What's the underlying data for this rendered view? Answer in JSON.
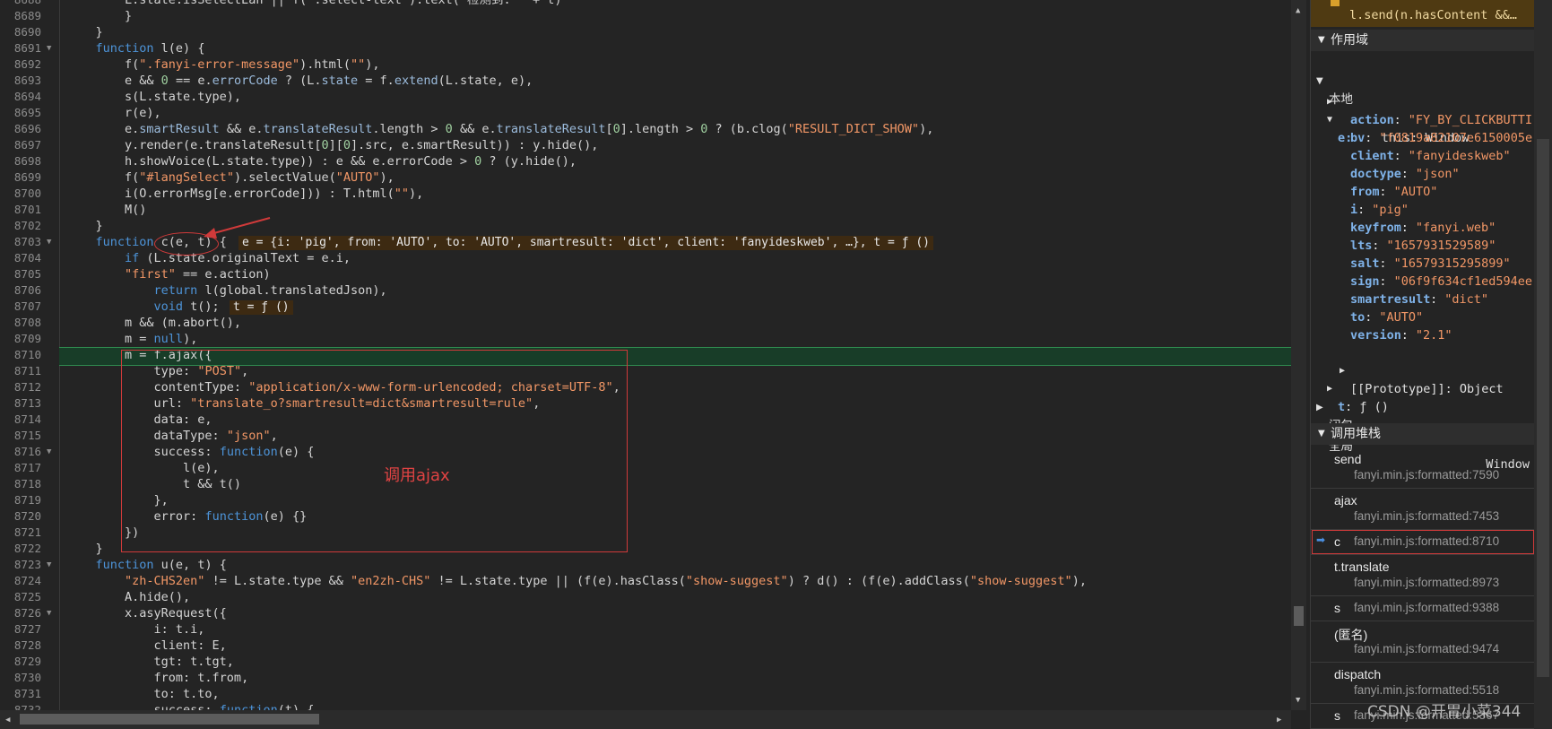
{
  "editor": {
    "lines": [
      {
        "n": "8688",
        "segs": [
          [
            "t-c",
            "        L.state.isSelectEan || f(\".select-text\").text(\"检测到: \" + t)"
          ]
        ]
      },
      {
        "n": "8689",
        "segs": [
          [
            "t-c",
            "        }"
          ]
        ]
      },
      {
        "n": "8690",
        "segs": [
          [
            "t-c",
            "    }"
          ]
        ]
      },
      {
        "n": "8691",
        "fold": true,
        "segs": [
          [
            "t-k",
            "    function"
          ],
          [
            "t-c",
            " l(e) {"
          ]
        ]
      },
      {
        "n": "8692",
        "segs": [
          [
            "t-c",
            "        f("
          ],
          [
            "t-s",
            "\".fanyi-error-message\""
          ],
          [
            "t-c",
            ").html("
          ],
          [
            "t-s",
            "\"\""
          ],
          [
            "t-c",
            "),"
          ]
        ]
      },
      {
        "n": "8693",
        "segs": [
          [
            "t-c",
            "        e && "
          ],
          [
            "t-n",
            "0"
          ],
          [
            "t-c",
            " == e."
          ],
          [
            "t-p",
            "errorCode"
          ],
          [
            "t-c",
            " ? (L."
          ],
          [
            "t-p",
            "state"
          ],
          [
            "t-c",
            " = f."
          ],
          [
            "t-p",
            "extend"
          ],
          [
            "t-c",
            "(L.state, e),"
          ]
        ]
      },
      {
        "n": "8694",
        "segs": [
          [
            "t-c",
            "        s(L.state.type),"
          ]
        ]
      },
      {
        "n": "8695",
        "segs": [
          [
            "t-c",
            "        r(e),"
          ]
        ]
      },
      {
        "n": "8696",
        "segs": [
          [
            "t-c",
            "        e."
          ],
          [
            "t-p",
            "smartResult"
          ],
          [
            "t-c",
            " && e."
          ],
          [
            "t-p",
            "translateResult"
          ],
          [
            "t-c",
            ".length > "
          ],
          [
            "t-n",
            "0"
          ],
          [
            "t-c",
            " && e."
          ],
          [
            "t-p",
            "translateResult"
          ],
          [
            "t-c",
            "["
          ],
          [
            "t-n",
            "0"
          ],
          [
            "t-c",
            "].length > "
          ],
          [
            "t-n",
            "0"
          ],
          [
            "t-c",
            " ? (b.clog("
          ],
          [
            "t-s",
            "\"RESULT_DICT_SHOW\""
          ],
          [
            "t-c",
            "),"
          ]
        ]
      },
      {
        "n": "8697",
        "segs": [
          [
            "t-c",
            "        y.render(e.translateResult["
          ],
          [
            "t-n",
            "0"
          ],
          [
            "t-c",
            "]["
          ],
          [
            "t-n",
            "0"
          ],
          [
            "t-c",
            "].src, e.smartResult)) : y.hide(),"
          ]
        ]
      },
      {
        "n": "8698",
        "segs": [
          [
            "t-c",
            "        h.showVoice(L.state.type)) : e && e.errorCode > "
          ],
          [
            "t-n",
            "0"
          ],
          [
            "t-c",
            " ? (y.hide(),"
          ]
        ]
      },
      {
        "n": "8699",
        "segs": [
          [
            "t-c",
            "        f("
          ],
          [
            "t-s",
            "\"#langSelect\""
          ],
          [
            "t-c",
            ").selectValue("
          ],
          [
            "t-s",
            "\"AUTO\""
          ],
          [
            "t-c",
            "),"
          ]
        ]
      },
      {
        "n": "8700",
        "segs": [
          [
            "t-c",
            "        i(O.errorMsg[e.errorCode])) : T.html("
          ],
          [
            "t-s",
            "\"\""
          ],
          [
            "t-c",
            "),"
          ]
        ]
      },
      {
        "n": "8701",
        "segs": [
          [
            "t-c",
            "        M()"
          ]
        ]
      },
      {
        "n": "8702",
        "segs": [
          [
            "t-c",
            "    }"
          ]
        ]
      },
      {
        "n": "8703",
        "fold": true,
        "segs": [
          [
            "t-k",
            "    function"
          ],
          [
            "t-c",
            " c(e, t) {"
          ]
        ]
      },
      {
        "n": "8704",
        "segs": [
          [
            "t-c",
            "        "
          ],
          [
            "t-k",
            "if"
          ],
          [
            "t-c",
            " (L.state.originalText = e.i,"
          ]
        ]
      },
      {
        "n": "8705",
        "segs": [
          [
            "t-s",
            "        \"first\""
          ],
          [
            "t-c",
            " == e.action)"
          ]
        ]
      },
      {
        "n": "8706",
        "segs": [
          [
            "t-k",
            "            return"
          ],
          [
            "t-c",
            " l(global.translatedJson),"
          ]
        ]
      },
      {
        "n": "8707",
        "segs": [
          [
            "t-k",
            "            void"
          ],
          [
            "t-c",
            " t();"
          ]
        ]
      },
      {
        "n": "8708",
        "segs": [
          [
            "t-c",
            "        m && (m.abort(),"
          ]
        ]
      },
      {
        "n": "8709",
        "segs": [
          [
            "t-c",
            "        m = "
          ],
          [
            "t-k",
            "null"
          ],
          [
            "t-c",
            "),"
          ]
        ]
      },
      {
        "n": "8710",
        "segs": [
          [
            "t-c",
            "        m = f.ajax({"
          ]
        ]
      },
      {
        "n": "8711",
        "segs": [
          [
            "t-c",
            "            type: "
          ],
          [
            "t-s",
            "\"POST\""
          ],
          [
            "t-c",
            ","
          ]
        ]
      },
      {
        "n": "8712",
        "segs": [
          [
            "t-c",
            "            contentType: "
          ],
          [
            "t-s",
            "\"application/x-www-form-urlencoded; charset=UTF-8\""
          ],
          [
            "t-c",
            ","
          ]
        ]
      },
      {
        "n": "8713",
        "segs": [
          [
            "t-c",
            "            url: "
          ],
          [
            "t-s",
            "\"translate_o?smartresult=dict&smartresult=rule\""
          ],
          [
            "t-c",
            ","
          ]
        ]
      },
      {
        "n": "8714",
        "segs": [
          [
            "t-c",
            "            data: e,"
          ]
        ]
      },
      {
        "n": "8715",
        "segs": [
          [
            "t-c",
            "            dataType: "
          ],
          [
            "t-s",
            "\"json\""
          ],
          [
            "t-c",
            ","
          ]
        ]
      },
      {
        "n": "8716",
        "fold": true,
        "segs": [
          [
            "t-c",
            "            success: "
          ],
          [
            "t-k",
            "function"
          ],
          [
            "t-c",
            "(e) {"
          ]
        ]
      },
      {
        "n": "8717",
        "segs": [
          [
            "t-c",
            "                l(e),"
          ]
        ]
      },
      {
        "n": "8718",
        "segs": [
          [
            "t-c",
            "                t && t()"
          ]
        ]
      },
      {
        "n": "8719",
        "segs": [
          [
            "t-c",
            "            },"
          ]
        ]
      },
      {
        "n": "8720",
        "segs": [
          [
            "t-c",
            "            error: "
          ],
          [
            "t-k",
            "function"
          ],
          [
            "t-c",
            "(e) {}"
          ]
        ]
      },
      {
        "n": "8721",
        "segs": [
          [
            "t-c",
            "        })"
          ]
        ]
      },
      {
        "n": "8722",
        "segs": [
          [
            "t-c",
            "    }"
          ]
        ]
      },
      {
        "n": "8723",
        "fold": true,
        "segs": [
          [
            "t-k",
            "    function"
          ],
          [
            "t-c",
            " u(e, t) {"
          ]
        ]
      },
      {
        "n": "8724",
        "segs": [
          [
            "t-s",
            "        \"zh-CHS2en\""
          ],
          [
            "t-c",
            " != L.state.type && "
          ],
          [
            "t-s",
            "\"en2zh-CHS\""
          ],
          [
            "t-c",
            " != L.state.type || (f(e).hasClass("
          ],
          [
            "t-s",
            "\"show-suggest\""
          ],
          [
            "t-c",
            ") ? d() : (f(e).addClass("
          ],
          [
            "t-s",
            "\"show-suggest\""
          ],
          [
            "t-c",
            "),"
          ]
        ]
      },
      {
        "n": "8725",
        "segs": [
          [
            "t-c",
            "        A.hide(),"
          ]
        ]
      },
      {
        "n": "8726",
        "fold": true,
        "segs": [
          [
            "t-c",
            "        x.asyRequest({"
          ]
        ]
      },
      {
        "n": "8727",
        "segs": [
          [
            "t-c",
            "            i: t.i,"
          ]
        ]
      },
      {
        "n": "8728",
        "segs": [
          [
            "t-c",
            "            client: E,"
          ]
        ]
      },
      {
        "n": "8729",
        "segs": [
          [
            "t-c",
            "            tgt: t.tgt,"
          ]
        ]
      },
      {
        "n": "8730",
        "segs": [
          [
            "t-c",
            "            from: t.from,"
          ]
        ]
      },
      {
        "n": "8731",
        "segs": [
          [
            "t-c",
            "            to: t.to,"
          ]
        ]
      },
      {
        "n": "8732",
        "segs": [
          [
            "t-c",
            "            success: "
          ],
          [
            "t-k",
            "function"
          ],
          [
            "t-c",
            "(t) {"
          ]
        ]
      }
    ],
    "inline_values": {
      "line_8703": "e = {i: 'pig', from: 'AUTO', to: 'AUTO', smartresult: 'dict', client: 'fanyideskweb', …}, t = ƒ ()",
      "line_8707": "t = ƒ ()"
    },
    "annotation": "调用ajax"
  },
  "panel": {
    "top_frame_text": "l.send(n.hasContent &&…",
    "scope_header": "作用域",
    "local_label": "本地",
    "this_row": {
      "key": "this",
      "value": "Window"
    },
    "e_label": "e:",
    "e_props": [
      {
        "key": "action",
        "value": "\"FY_BY_CLICKBUTTI"
      },
      {
        "key": "bv",
        "value": "\"f0819a82107e6150005e"
      },
      {
        "key": "client",
        "value": "\"fanyideskweb\""
      },
      {
        "key": "doctype",
        "value": "\"json\""
      },
      {
        "key": "from",
        "value": "\"AUTO\""
      },
      {
        "key": "i",
        "value": "\"pig\""
      },
      {
        "key": "keyfrom",
        "value": "\"fanyi.web\""
      },
      {
        "key": "lts",
        "value": "\"1657931529589\""
      },
      {
        "key": "salt",
        "value": "\"16579315295899\""
      },
      {
        "key": "sign",
        "value": "\"06f9f634cf1ed594ee"
      },
      {
        "key": "smartresult",
        "value": "\"dict\""
      },
      {
        "key": "to",
        "value": "\"AUTO\""
      },
      {
        "key": "version",
        "value": "\"2.1\""
      }
    ],
    "prototype_row": "[[Prototype]]: Object",
    "t_row": {
      "key": "t",
      "value": "ƒ ()"
    },
    "closure_label": "闭包",
    "global_label": "全局",
    "global_value": "Window",
    "callstack_header": "调用堆栈",
    "frames": [
      {
        "name": "send",
        "loc": "fanyi.min.js:formatted:7590",
        "layout": "two"
      },
      {
        "name": "ajax",
        "loc": "fanyi.min.js:formatted:7453",
        "layout": "two"
      },
      {
        "name": "c",
        "loc": "fanyi.min.js:formatted:8710",
        "layout": "one",
        "active": true
      },
      {
        "name": "t.translate",
        "loc": "fanyi.min.js:formatted:8973",
        "layout": "two"
      },
      {
        "name": "s",
        "loc": "fanyi.min.js:formatted:9388",
        "layout": "one"
      },
      {
        "name": "(匿名)",
        "loc": "fanyi.min.js:formatted:9474",
        "layout": "two"
      },
      {
        "name": "dispatch",
        "loc": "fanyi.min.js:formatted:5518",
        "layout": "two"
      },
      {
        "name": "s",
        "loc": "fanyi.min.js:formatted:5367",
        "layout": "one"
      }
    ]
  },
  "watermark": "CSDN @开胃小菜344"
}
